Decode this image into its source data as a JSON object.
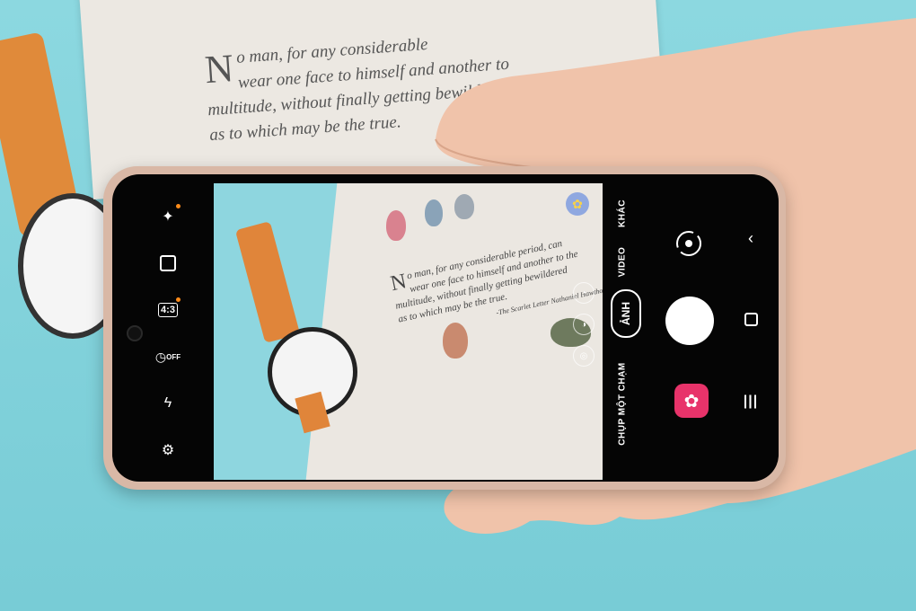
{
  "scene": {
    "background_color": "#7fd3dc",
    "book_text": [
      "N",
      "o man, for any considerable",
      "wear one face to himself and another to",
      "multitude, without finally getting bewildered",
      "as to which may be the true."
    ]
  },
  "viewfinder": {
    "book_text": [
      "N",
      "o man, for any considerable period, can",
      "wear one face to himself and another to the",
      "multitude, without finally getting bewildered",
      "as to which may be the true.",
      "-The Scarlet Letter  Nathaniel Hawthorne"
    ]
  },
  "left_bar": {
    "effects_icon": "magic-wand-icon",
    "motion_photo_icon": "motion-photo-icon",
    "ratio_label": "4:3",
    "timer_label": "OFF",
    "flash_icon": "flash-off-icon",
    "settings_icon": "gear-icon",
    "accent_dot_color": "#ff8c1a"
  },
  "right_panel": {
    "modes": {
      "more": "KHÁC",
      "video": "VIDEO",
      "photo": "ẢNH",
      "single_take": "CHỤP MỘT CHẠM"
    },
    "flip_icon": "camera-flip-icon",
    "sticker_icon": "flower-icon",
    "sticker_color": "#e8336a"
  },
  "nav": {
    "back_icon": "chevron-left-icon",
    "home_icon": "square-icon",
    "recents_icon": "menu-lines-icon"
  }
}
